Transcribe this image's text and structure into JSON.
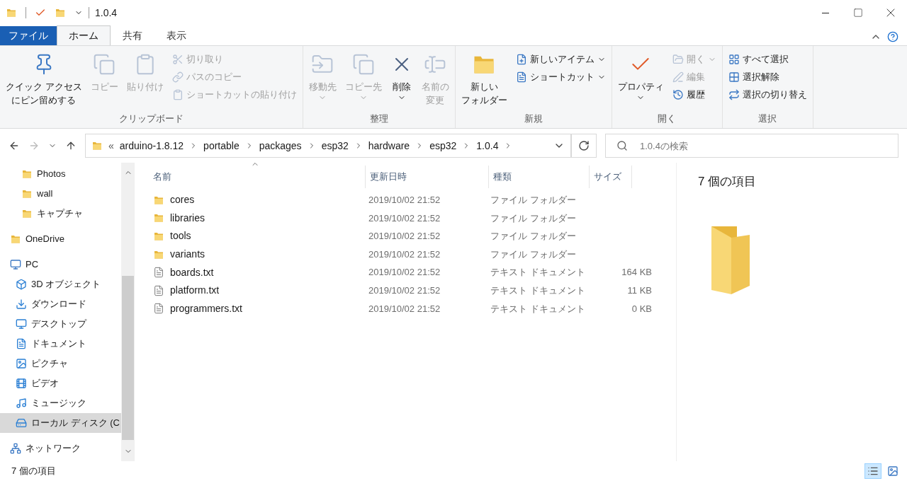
{
  "window": {
    "title": "1.0.4"
  },
  "tabs": [
    {
      "label": "ファイル",
      "kind": "file",
      "selected": false
    },
    {
      "label": "ホーム",
      "kind": "tab",
      "selected": true
    },
    {
      "label": "共有",
      "kind": "tab",
      "selected": false
    },
    {
      "label": "表示",
      "kind": "tab",
      "selected": false
    }
  ],
  "ribbon": {
    "groups": [
      {
        "label": "クリップボード",
        "items": [
          {
            "lines": [
              "クイック アクセス",
              "にピン留めする"
            ],
            "kind": "large",
            "disabled": false,
            "dropdown": false
          },
          {
            "lines": [
              "コピー"
            ],
            "kind": "large",
            "disabled": true,
            "dropdown": false
          },
          {
            "lines": [
              "貼り付け"
            ],
            "kind": "large",
            "disabled": true,
            "dropdown": false
          },
          {
            "label": "切り取り",
            "kind": "small",
            "disabled": true,
            "dropdown": false
          },
          {
            "label": "パスのコピー",
            "kind": "small",
            "disabled": true,
            "dropdown": false
          },
          {
            "label": "ショートカットの貼り付け",
            "kind": "small",
            "disabled": true,
            "dropdown": false
          }
        ]
      },
      {
        "label": "整理",
        "items": [
          {
            "lines": [
              "移動先"
            ],
            "kind": "large",
            "disabled": true,
            "dropdown": true
          },
          {
            "lines": [
              "コピー先"
            ],
            "kind": "large",
            "disabled": true,
            "dropdown": true
          },
          {
            "lines": [
              "削除"
            ],
            "kind": "large",
            "disabled": false,
            "dropdown": true
          },
          {
            "lines": [
              "名前の",
              "変更"
            ],
            "kind": "large",
            "disabled": true,
            "dropdown": false
          }
        ]
      },
      {
        "label": "新規",
        "items": [
          {
            "lines": [
              "新しい",
              "フォルダー"
            ],
            "kind": "large",
            "disabled": false,
            "dropdown": false
          },
          {
            "label": "新しいアイテム",
            "kind": "small",
            "disabled": false,
            "dropdown": true
          },
          {
            "label": "ショートカット",
            "kind": "small",
            "disabled": false,
            "dropdown": true
          }
        ]
      },
      {
        "label": "開く",
        "items": [
          {
            "lines": [
              "プロパティ"
            ],
            "kind": "large",
            "disabled": false,
            "dropdown": true
          },
          {
            "label": "開く",
            "kind": "small",
            "disabled": true,
            "dropdown": true
          },
          {
            "label": "編集",
            "kind": "small",
            "disabled": true,
            "dropdown": false
          },
          {
            "label": "履歴",
            "kind": "small",
            "disabled": false,
            "dropdown": false
          }
        ]
      },
      {
        "label": "選択",
        "items": [
          {
            "label": "すべて選択",
            "kind": "small",
            "disabled": false,
            "dropdown": false
          },
          {
            "label": "選択解除",
            "kind": "small",
            "disabled": false,
            "dropdown": false
          },
          {
            "label": "選択の切り替え",
            "kind": "small",
            "disabled": false,
            "dropdown": false
          }
        ]
      }
    ]
  },
  "address": {
    "overflow": "«",
    "segments": [
      "arduino-1.8.12",
      "portable",
      "packages",
      "esp32",
      "hardware",
      "esp32",
      "1.0.4"
    ]
  },
  "search": {
    "placeholder": "1.0.4の検索"
  },
  "nav_pane": {
    "continued": [
      {
        "label": "Photos",
        "selected": false
      },
      {
        "label": "wall",
        "selected": false
      },
      {
        "label": "キャプチャ",
        "selected": false
      }
    ],
    "items": [
      {
        "label": "OneDrive",
        "selected": false
      },
      {
        "label": "PC",
        "selected": false,
        "children": [
          {
            "label": "3D オブジェクト",
            "selected": false
          },
          {
            "label": "ダウンロード",
            "selected": false
          },
          {
            "label": "デスクトップ",
            "selected": false
          },
          {
            "label": "ドキュメント",
            "selected": false
          },
          {
            "label": "ピクチャ",
            "selected": false
          },
          {
            "label": "ビデオ",
            "selected": false
          },
          {
            "label": "ミュージック",
            "selected": false
          },
          {
            "label": "ローカル ディスク (C",
            "selected": true
          }
        ]
      },
      {
        "label": "ネットワーク",
        "selected": false
      }
    ]
  },
  "table": {
    "columns": [
      "名前",
      "更新日時",
      "種類",
      "サイズ"
    ],
    "rows": [
      {
        "kind": "folder",
        "name": "cores",
        "modified": "2019/10/02 21:52",
        "type": "ファイル フォルダー"
      },
      {
        "kind": "folder",
        "name": "libraries",
        "modified": "2019/10/02 21:52",
        "type": "ファイル フォルダー"
      },
      {
        "kind": "folder",
        "name": "tools",
        "modified": "2019/10/02 21:52",
        "type": "ファイル フォルダー"
      },
      {
        "kind": "folder",
        "name": "variants",
        "modified": "2019/10/02 21:52",
        "type": "ファイル フォルダー"
      },
      {
        "kind": "file",
        "name": "boards.txt",
        "modified": "2019/10/02 21:52",
        "type": "テキスト ドキュメント",
        "size": "164 KB"
      },
      {
        "kind": "file",
        "name": "platform.txt",
        "modified": "2019/10/02 21:52",
        "type": "テキスト ドキュメント",
        "size": "11 KB"
      },
      {
        "kind": "file",
        "name": "programmers.txt",
        "modified": "2019/10/02 21:52",
        "type": "テキスト ドキュメント",
        "size": "0 KB"
      }
    ]
  },
  "preview": {
    "title": "7 個の項目"
  },
  "status_bar": {
    "text": "7 個の項目",
    "view_buttons": [
      {
        "selected": true
      },
      {
        "selected": false
      }
    ]
  }
}
